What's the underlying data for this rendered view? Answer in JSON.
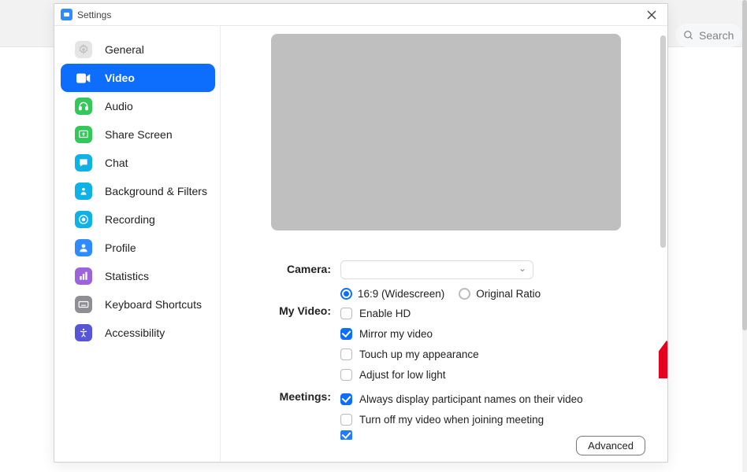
{
  "bg_search": {
    "placeholder": "Search"
  },
  "window": {
    "title": "Settings",
    "advanced_label": "Advanced"
  },
  "sidebar": {
    "items": [
      {
        "label": "General",
        "icon": "gear",
        "bg": "#e5e5e5"
      },
      {
        "label": "Video",
        "icon": "video",
        "bg": "#ffffff",
        "active": true
      },
      {
        "label": "Audio",
        "icon": "headset",
        "bg": "#34c759"
      },
      {
        "label": "Share Screen",
        "icon": "share",
        "bg": "#34c759"
      },
      {
        "label": "Chat",
        "icon": "chat",
        "bg": "#10b2e6"
      },
      {
        "label": "Background & Filters",
        "icon": "bg",
        "bg": "#10b2e6"
      },
      {
        "label": "Recording",
        "icon": "record",
        "bg": "#10b2e6"
      },
      {
        "label": "Profile",
        "icon": "profile",
        "bg": "#2f8bff"
      },
      {
        "label": "Statistics",
        "icon": "stats",
        "bg": "#9d63da"
      },
      {
        "label": "Keyboard Shortcuts",
        "icon": "keyboard",
        "bg": "#8e8e93"
      },
      {
        "label": "Accessibility",
        "icon": "access",
        "bg": "#5856d6"
      }
    ]
  },
  "video": {
    "camera_label": "Camera:",
    "aspect": {
      "wide": "16:9 (Widescreen)",
      "original": "Original Ratio"
    },
    "myvideo_label": "My Video:",
    "enable_hd": "Enable HD",
    "mirror": "Mirror my video",
    "touchup": "Touch up my appearance",
    "lowlight": "Adjust for low light",
    "meetings_label": "Meetings:",
    "always_names": "Always display participant names on their video",
    "turn_off": "Turn off my video when joining meeting"
  }
}
